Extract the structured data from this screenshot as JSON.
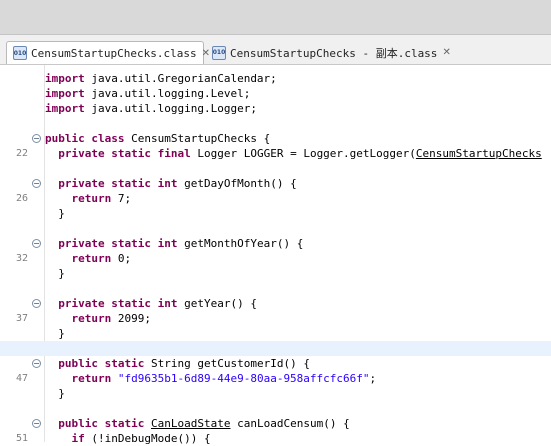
{
  "tabs": [
    {
      "label": "CensumStartupChecks.class",
      "icon": "class-file-icon",
      "active": true
    },
    {
      "label": "CensumStartupChecks - 副本.class",
      "icon": "class-file-icon",
      "active": false
    }
  ],
  "code": {
    "highlight_color": "#e8f2fe",
    "keyword_color": "#7f0055",
    "string_color": "#2a00ff",
    "lines": [
      {
        "num": "",
        "fold": false,
        "segs": [
          {
            "t": "import",
            "c": "kw"
          },
          {
            "t": " java.util.GregorianCalendar;"
          }
        ]
      },
      {
        "num": "",
        "fold": false,
        "segs": [
          {
            "t": "import",
            "c": "kw"
          },
          {
            "t": " java.util.logging.Level;"
          }
        ]
      },
      {
        "num": "",
        "fold": false,
        "segs": [
          {
            "t": "import",
            "c": "kw"
          },
          {
            "t": " java.util.logging.Logger;"
          }
        ]
      },
      {
        "num": "",
        "fold": false,
        "segs": []
      },
      {
        "num": "",
        "fold": true,
        "segs": [
          {
            "t": "public",
            "c": "kw"
          },
          {
            "t": " "
          },
          {
            "t": "class",
            "c": "kw"
          },
          {
            "t": " CensumStartupChecks {"
          }
        ]
      },
      {
        "num": "22",
        "fold": false,
        "segs": [
          {
            "t": "  "
          },
          {
            "t": "private",
            "c": "kw"
          },
          {
            "t": " "
          },
          {
            "t": "static",
            "c": "kw"
          },
          {
            "t": " "
          },
          {
            "t": "final",
            "c": "kw"
          },
          {
            "t": " Logger LOGGER = Logger.getLogger("
          },
          {
            "t": "CensumStartupChecks",
            "c": "ul"
          }
        ]
      },
      {
        "num": "",
        "fold": false,
        "segs": []
      },
      {
        "num": "",
        "fold": true,
        "segs": [
          {
            "t": "  "
          },
          {
            "t": "private",
            "c": "kw"
          },
          {
            "t": " "
          },
          {
            "t": "static",
            "c": "kw"
          },
          {
            "t": " "
          },
          {
            "t": "int",
            "c": "kw"
          },
          {
            "t": " getDayOfMonth() {"
          }
        ]
      },
      {
        "num": "26",
        "fold": false,
        "segs": [
          {
            "t": "    "
          },
          {
            "t": "return",
            "c": "kw"
          },
          {
            "t": " 7;"
          }
        ]
      },
      {
        "num": "",
        "fold": false,
        "segs": [
          {
            "t": "  }"
          }
        ]
      },
      {
        "num": "",
        "fold": false,
        "segs": []
      },
      {
        "num": "",
        "fold": true,
        "segs": [
          {
            "t": "  "
          },
          {
            "t": "private",
            "c": "kw"
          },
          {
            "t": " "
          },
          {
            "t": "static",
            "c": "kw"
          },
          {
            "t": " "
          },
          {
            "t": "int",
            "c": "kw"
          },
          {
            "t": " getMonthOfYear() {"
          }
        ]
      },
      {
        "num": "32",
        "fold": false,
        "segs": [
          {
            "t": "    "
          },
          {
            "t": "return",
            "c": "kw"
          },
          {
            "t": " 0;"
          }
        ]
      },
      {
        "num": "",
        "fold": false,
        "segs": [
          {
            "t": "  }"
          }
        ]
      },
      {
        "num": "",
        "fold": false,
        "segs": []
      },
      {
        "num": "",
        "fold": true,
        "segs": [
          {
            "t": "  "
          },
          {
            "t": "private",
            "c": "kw"
          },
          {
            "t": " "
          },
          {
            "t": "static",
            "c": "kw"
          },
          {
            "t": " "
          },
          {
            "t": "int",
            "c": "kw"
          },
          {
            "t": " getYear() {"
          }
        ]
      },
      {
        "num": "37",
        "fold": false,
        "segs": [
          {
            "t": "    "
          },
          {
            "t": "return",
            "c": "kw"
          },
          {
            "t": " 2099;"
          }
        ]
      },
      {
        "num": "",
        "fold": false,
        "segs": [
          {
            "t": "  }"
          }
        ]
      },
      {
        "num": "",
        "fold": false,
        "highlight": true,
        "segs": []
      },
      {
        "num": "",
        "fold": true,
        "segs": [
          {
            "t": "  "
          },
          {
            "t": "public",
            "c": "kw"
          },
          {
            "t": " "
          },
          {
            "t": "static",
            "c": "kw"
          },
          {
            "t": " String getCustomerId() {"
          }
        ]
      },
      {
        "num": "47",
        "fold": false,
        "segs": [
          {
            "t": "    "
          },
          {
            "t": "return",
            "c": "kw"
          },
          {
            "t": " "
          },
          {
            "t": "\"fd9635b1-6d89-44e9-80aa-958affcfc66f\"",
            "c": "str"
          },
          {
            "t": ";"
          }
        ]
      },
      {
        "num": "",
        "fold": false,
        "segs": [
          {
            "t": "  }"
          }
        ]
      },
      {
        "num": "",
        "fold": false,
        "segs": []
      },
      {
        "num": "",
        "fold": true,
        "segs": [
          {
            "t": "  "
          },
          {
            "t": "public",
            "c": "kw"
          },
          {
            "t": " "
          },
          {
            "t": "static",
            "c": "kw"
          },
          {
            "t": " "
          },
          {
            "t": "CanLoadState",
            "c": "ul"
          },
          {
            "t": " canLoadCensum() {"
          }
        ]
      },
      {
        "num": "51",
        "fold": false,
        "segs": [
          {
            "t": "    "
          },
          {
            "t": "if",
            "c": "kw"
          },
          {
            "t": " (!inDebugMode()) {"
          }
        ]
      }
    ]
  }
}
